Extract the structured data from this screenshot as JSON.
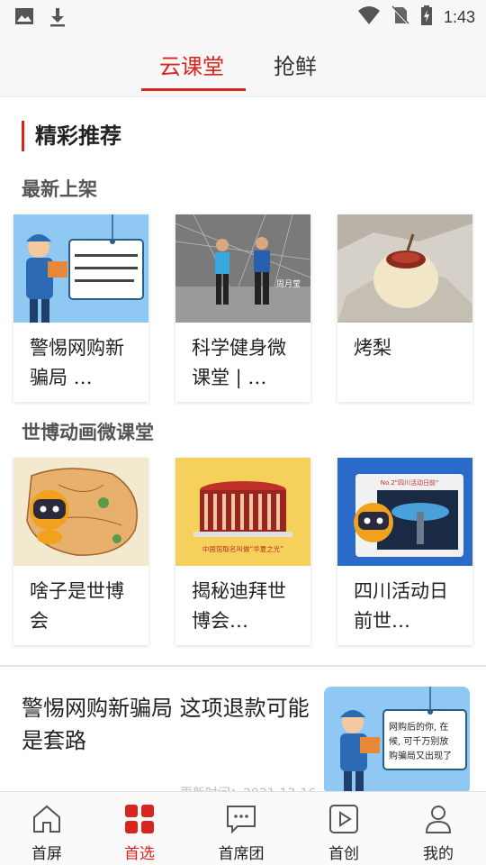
{
  "status_bar": {
    "time": "1:43"
  },
  "tabs": [
    {
      "label": "云课堂",
      "active": true
    },
    {
      "label": "抢鲜",
      "active": false
    }
  ],
  "section": {
    "title": "精彩推荐",
    "groups": [
      {
        "title": "最新上架",
        "cards": [
          {
            "title": "警惕网购新骗局 …",
            "image": "courier-cartoon"
          },
          {
            "title": "科学健身微课堂 | …",
            "image": "fitness-video",
            "image_text": "周月莹"
          },
          {
            "title": "烤梨",
            "image": "roasted-pear"
          }
        ]
      },
      {
        "title": "世博动画微课堂",
        "cards": [
          {
            "title": "啥子是世博会",
            "image": "map-mascot"
          },
          {
            "title": "揭秘迪拜世博会…",
            "image": "china-pavilion",
            "image_text": "中国馆取名叫做“华夏之光”"
          },
          {
            "title": "四川活动日前世…",
            "image": "sichuan-pavilion",
            "image_text": "No.2\"四川活动日前\""
          }
        ]
      }
    ]
  },
  "article": {
    "headline": "警惕网购新骗局 这项退款可能是套路",
    "time": "更新时间：2021-12-16",
    "bubble_text": [
      "网购后的你, 在",
      "候, 可千万别放",
      "购骗局又出现了"
    ]
  },
  "bottom_nav": [
    {
      "label": "首屏",
      "icon": "home-icon",
      "active": false
    },
    {
      "label": "首选",
      "icon": "grid-icon",
      "active": true
    },
    {
      "label": "首席团",
      "icon": "chat-icon",
      "active": false
    },
    {
      "label": "首创",
      "icon": "video-icon",
      "active": false
    },
    {
      "label": "我的",
      "icon": "person-icon",
      "active": false
    }
  ],
  "colors": {
    "accent": "#d8261e"
  }
}
